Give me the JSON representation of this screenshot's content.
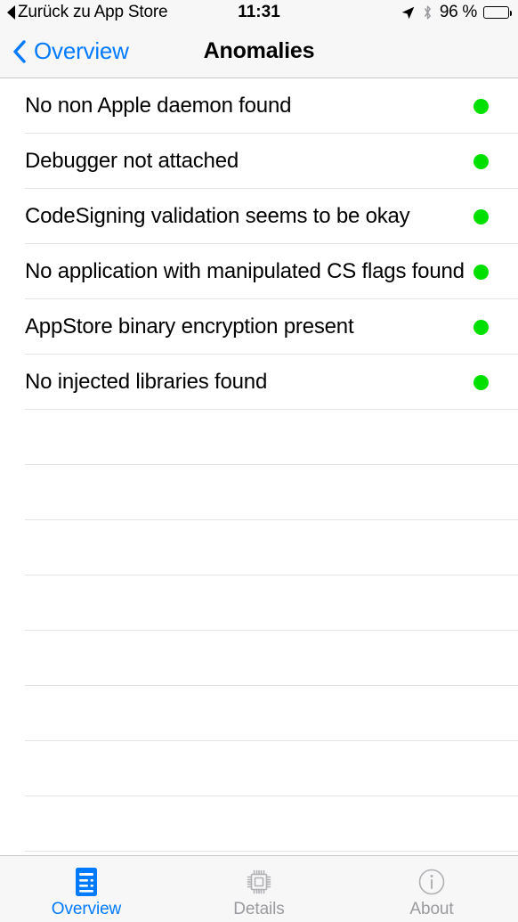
{
  "status_bar": {
    "back_label": "Zurück zu App Store",
    "back_icon": "triangle-left-icon",
    "time": "11:31",
    "location_icon": "location-arrow-icon",
    "bluetooth_icon": "bluetooth-icon",
    "battery_percent": "96 %",
    "battery_icon": "battery-full-icon",
    "battery_level": 96
  },
  "nav_bar": {
    "back_label": "Overview",
    "back_icon": "chevron-left-icon",
    "title": "Anomalies",
    "accent_color": "#007aff"
  },
  "list": {
    "dot_color": "#00e000",
    "rows": [
      {
        "label": "No non Apple daemon found",
        "status": "ok"
      },
      {
        "label": "Debugger not attached",
        "status": "ok"
      },
      {
        "label": "CodeSigning validation seems to be okay",
        "status": "ok"
      },
      {
        "label": "No application with manipulated CS flags found",
        "status": "ok"
      },
      {
        "label": "AppStore binary encryption present",
        "status": "ok"
      },
      {
        "label": "No injected libraries found",
        "status": "ok"
      }
    ],
    "empty_rows": 8
  },
  "tab_bar": {
    "active_color": "#007aff",
    "inactive_color": "#9a9a9f",
    "tabs": [
      {
        "label": "Overview",
        "icon": "document-list-icon",
        "active": true
      },
      {
        "label": "Details",
        "icon": "cpu-chip-icon",
        "active": false
      },
      {
        "label": "About",
        "icon": "info-circle-icon",
        "active": false
      }
    ]
  }
}
